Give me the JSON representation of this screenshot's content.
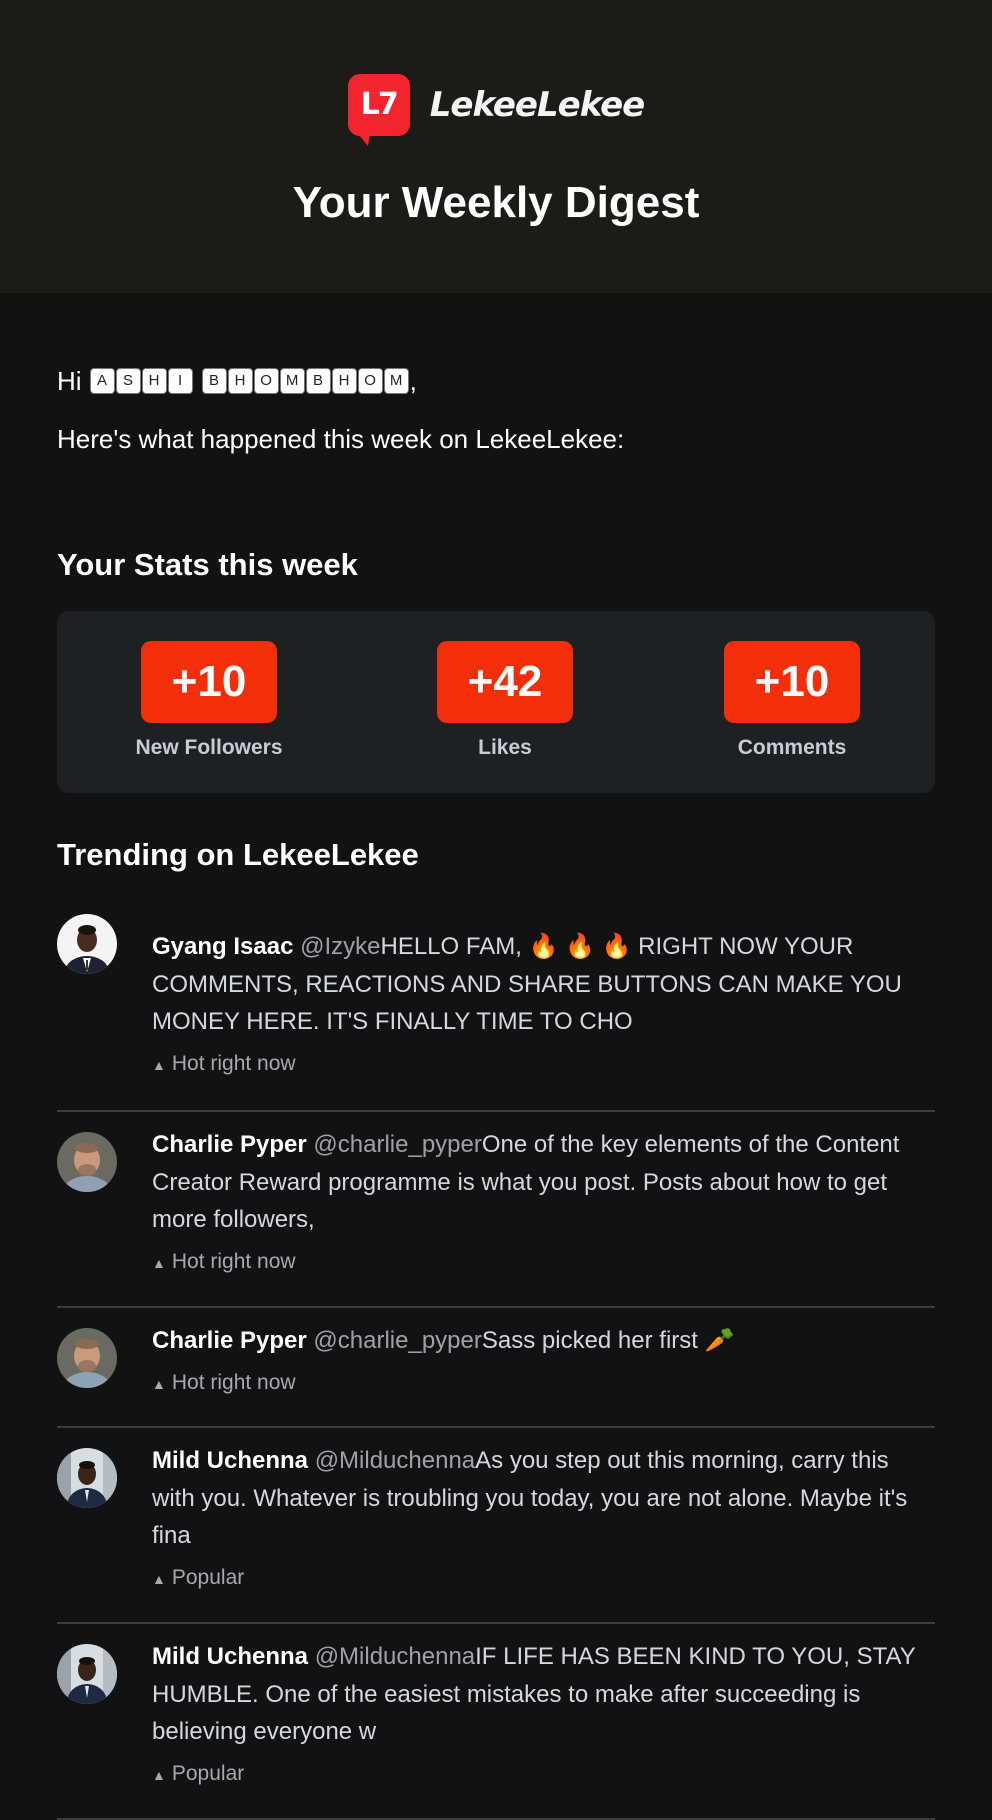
{
  "header": {
    "logo_glyph": "L7",
    "brand_name": "LekeeLekee",
    "title": "Your Weekly Digest"
  },
  "greeting": {
    "hi": "Hi",
    "name_first_letters": [
      "A",
      "S",
      "H",
      "I"
    ],
    "name_last_letters": [
      "B",
      "H",
      "O",
      "M",
      "B",
      "H",
      "O",
      "M"
    ],
    "comma": ",",
    "intro": "Here's what happened this week on LekeeLekee:"
  },
  "stats": {
    "title": "Your Stats this week",
    "items": [
      {
        "value": "+10",
        "label": "New Followers"
      },
      {
        "value": "+42",
        "label": "Likes"
      },
      {
        "value": "+10",
        "label": "Comments"
      }
    ]
  },
  "trending": {
    "title": "Trending on LekeeLekee",
    "posts": [
      {
        "author": "Gyang Isaac",
        "handle": "@Izyke",
        "text": "HELLO FAM, 🔥 🔥 🔥 RIGHT NOW YOUR COMMENTS, REACTIONS AND SHARE BUTTONS CAN MAKE YOU MONEY HERE. IT'S FINALLY TIME TO CHO",
        "badge": "Hot right now",
        "avatar": "avatar-gyang-isaac"
      },
      {
        "author": "Charlie Pyper",
        "handle": "@charlie_pyper",
        "text": "One of the key elements of the Content Creator Reward programme is what you post. Posts about how to get more followers,",
        "badge": "Hot right now",
        "avatar": "avatar-charlie-pyper"
      },
      {
        "author": "Charlie Pyper",
        "handle": "@charlie_pyper",
        "text": "Sass picked her first 🥕",
        "badge": "Hot right now",
        "avatar": "avatar-charlie-pyper"
      },
      {
        "author": "Mild Uchenna",
        "handle": "@Milduchenna",
        "text": "As you step out this morning, carry this with you. Whatever is troubling you today, you are not alone. Maybe it's fina",
        "badge": "Popular",
        "avatar": "avatar-mild-uchenna"
      },
      {
        "author": "Mild Uchenna",
        "handle": "@Milduchenna",
        "text": "IF LIFE HAS BEEN KIND TO YOU, STAY HUMBLE. One of the easiest mistakes to make after succeeding is believing everyone w",
        "badge": "Popular",
        "avatar": "avatar-mild-uchenna"
      }
    ]
  },
  "colors": {
    "background": "#121212",
    "header_bg": "#1b1b18",
    "brand_red": "#f2242d",
    "stat_orange": "#f22f0a",
    "card_bg": "#1f2022"
  }
}
